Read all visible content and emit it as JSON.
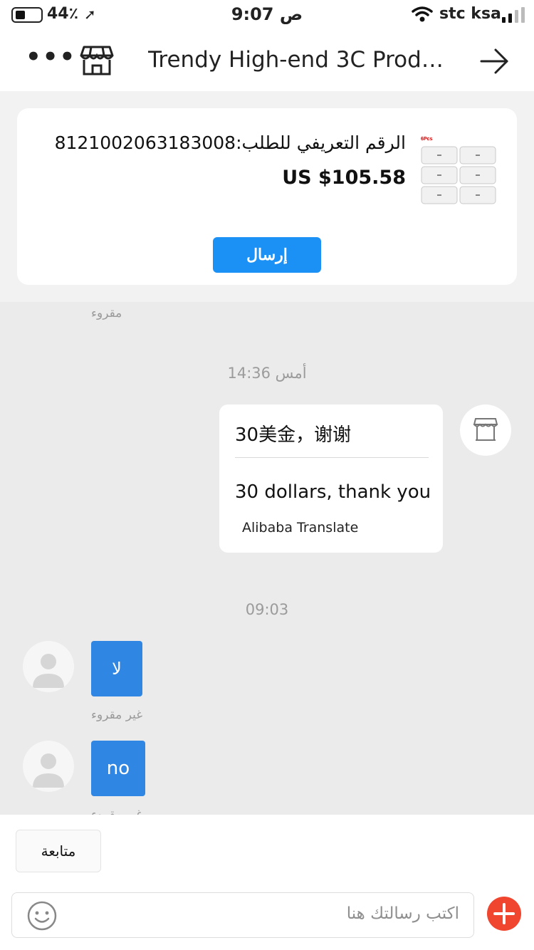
{
  "status_bar": {
    "battery": "44٪",
    "time": "9:07 ص",
    "carrier": "stc ksa"
  },
  "header": {
    "more_icon": "more-dots-icon",
    "store_icon": "store-icon",
    "title": "Trendy High-end 3C Produ...",
    "forward_icon": "arrow-right-icon"
  },
  "order": {
    "id_text": "الرقم التعريفي للطلب:8121002063183008",
    "price": "US $105.58",
    "thumb_label": "6Pcs",
    "send_label": "إرسال"
  },
  "chat": {
    "read_status_1": "مقروء",
    "time_sep_1": "أمس 14:36",
    "store_message": {
      "original": "30美金，谢谢",
      "translated": "30 dollars, thank you",
      "translator": "Alibaba Translate"
    },
    "time_sep_2": "09:03",
    "user_messages": [
      {
        "text": "لا",
        "status": "غير مقروء"
      },
      {
        "text": "no",
        "status": "غير مقروء"
      }
    ]
  },
  "bottom": {
    "follow_label": "متابعة",
    "input_placeholder": "اكتب رسالتك هنا",
    "emoji_icon": "emoji-icon",
    "plus_icon": "plus-icon"
  },
  "colors": {
    "accent_blue": "#1c91f5",
    "bubble_blue": "#2f86e3",
    "plus_red": "#f0452f"
  }
}
